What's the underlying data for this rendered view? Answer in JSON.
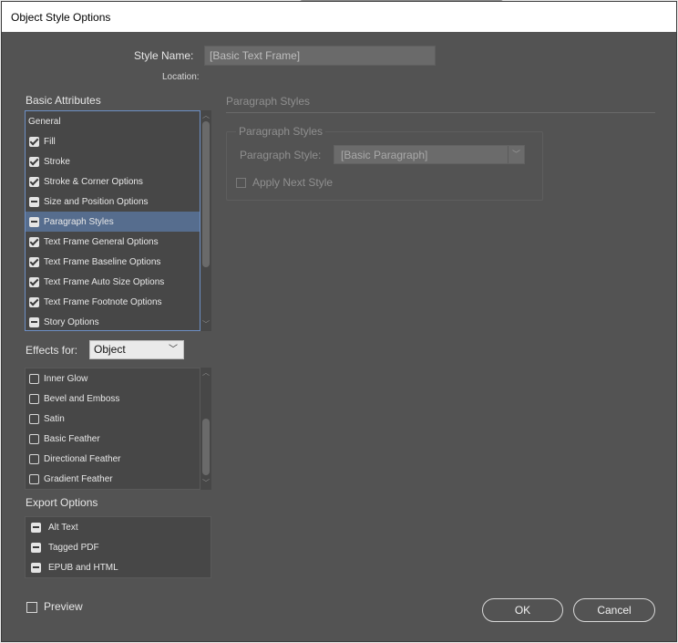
{
  "window": {
    "title": "Object Style Options"
  },
  "style_name": {
    "label": "Style Name:",
    "value": "[Basic Text Frame]"
  },
  "location": {
    "label": "Location:"
  },
  "basic_attributes": {
    "heading": "Basic Attributes",
    "items": [
      {
        "label": "General",
        "state": "none"
      },
      {
        "label": "Fill",
        "state": "checked"
      },
      {
        "label": "Stroke",
        "state": "checked"
      },
      {
        "label": "Stroke & Corner Options",
        "state": "checked"
      },
      {
        "label": "Size and Position Options",
        "state": "mixed"
      },
      {
        "label": "Paragraph Styles",
        "state": "mixed",
        "selected": true
      },
      {
        "label": "Text Frame General Options",
        "state": "checked"
      },
      {
        "label": "Text Frame Baseline Options",
        "state": "checked"
      },
      {
        "label": "Text Frame Auto Size Options",
        "state": "checked"
      },
      {
        "label": "Text Frame Footnote Options",
        "state": "checked"
      },
      {
        "label": "Story Options",
        "state": "mixed"
      }
    ]
  },
  "effects": {
    "label": "Effects for:",
    "selected": "Object",
    "items": [
      {
        "label": "Inner Glow",
        "state": "unchecked"
      },
      {
        "label": "Bevel and Emboss",
        "state": "unchecked"
      },
      {
        "label": "Satin",
        "state": "unchecked"
      },
      {
        "label": "Basic Feather",
        "state": "unchecked"
      },
      {
        "label": "Directional Feather",
        "state": "unchecked"
      },
      {
        "label": "Gradient Feather",
        "state": "unchecked"
      }
    ]
  },
  "export_options": {
    "heading": "Export Options",
    "items": [
      {
        "label": "Alt Text",
        "state": "mixed"
      },
      {
        "label": "Tagged PDF",
        "state": "mixed"
      },
      {
        "label": "EPUB and HTML",
        "state": "mixed"
      }
    ]
  },
  "panel": {
    "heading": "Paragraph Styles",
    "group_title": "Paragraph Styles",
    "paragraph_style_label": "Paragraph Style:",
    "paragraph_style_value": "[Basic Paragraph]",
    "apply_next_label": "Apply Next Style"
  },
  "preview": {
    "label": "Preview",
    "checked": false
  },
  "buttons": {
    "ok": "OK",
    "cancel": "Cancel"
  },
  "colors": {
    "dialog_bg": "#535353",
    "selection": "#566d8e",
    "list_bg": "#474747"
  }
}
